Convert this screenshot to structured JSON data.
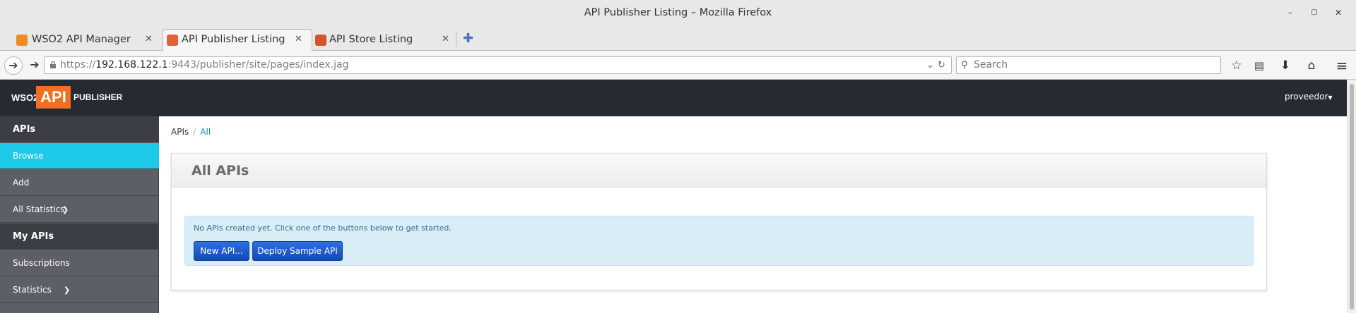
{
  "window": {
    "title": "API Publisher Listing – Mozilla Firefox"
  },
  "tabs": [
    {
      "label": "WSO2 API Manager",
      "active": false
    },
    {
      "label": "API Publisher Listing",
      "active": true
    },
    {
      "label": "API Store Listing",
      "active": false
    }
  ],
  "urlbar": {
    "scheme": "https://",
    "host": "192.168.122.1",
    "rest": ":9443/publisher/site/pages/index.jag"
  },
  "search": {
    "placeholder": "Search"
  },
  "header": {
    "logo": {
      "wso2": "WSO2",
      "api": "API",
      "publisher": "PUBLISHER"
    },
    "user": "proveedor"
  },
  "sidebar": {
    "items": [
      {
        "label": "APIs",
        "kind": "heading"
      },
      {
        "label": "Browse",
        "kind": "active"
      },
      {
        "label": "Add",
        "kind": "item"
      },
      {
        "label": "All Statistics",
        "kind": "item"
      },
      {
        "label": "My APIs",
        "kind": "heading"
      },
      {
        "label": "Subscriptions",
        "kind": "item"
      },
      {
        "label": "Statistics",
        "kind": "item"
      }
    ]
  },
  "breadcrumb": {
    "root": "APIs",
    "current": "All"
  },
  "panel": {
    "title": "All APIs",
    "message": "No APIs created yet. Click one of the buttons below to get started.",
    "buttons": {
      "new_api": "New API...",
      "deploy_sample": "Deploy Sample API"
    }
  },
  "colors": {
    "header_bg": "#252a33",
    "sidebar_bg": "#5c5f66",
    "sidebar_active": "#1dc9e8",
    "logo_orange": "#f26f21",
    "button_blue": "#1e5fd6",
    "alert_bg": "#d9edf7"
  }
}
